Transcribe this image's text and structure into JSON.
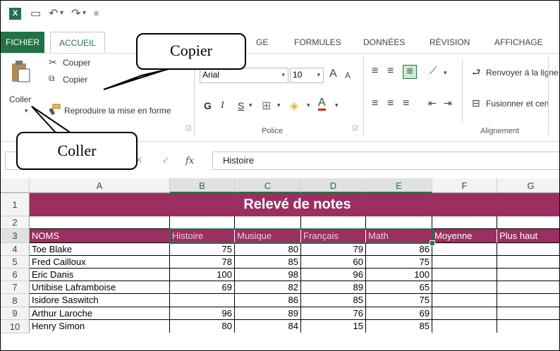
{
  "app": {
    "logo": "X",
    "quick_access": [
      "save-icon",
      "undo-icon",
      "redo-icon",
      "customize-icon"
    ]
  },
  "tabs": {
    "file": "FICHIER",
    "home": "ACCUEIL",
    "insert_tail": "GE",
    "formulas": "FORMULES",
    "data": "DONNÉES",
    "review": "RÉVISION",
    "view": "AFFICHAGE"
  },
  "clipboard": {
    "paste": "Coller",
    "cut": "Couper",
    "copy": "Copier",
    "format_painter": "Reproduire la mise en forme"
  },
  "font": {
    "name": "Arial",
    "size": "10",
    "bold": "G",
    "italic": "I",
    "underline": "S",
    "grow": "A",
    "shrink": "A",
    "group_label": "Police"
  },
  "alignment": {
    "wrap_text": "Renvoyer à la ligne",
    "merge": "Fusionner et cen",
    "group_label": "Alignement"
  },
  "formula_bar": {
    "cancel": "✕",
    "enter": "✓",
    "fx": "fx",
    "content": "Histoire"
  },
  "columns": [
    "A",
    "B",
    "C",
    "D",
    "E",
    "F",
    "G"
  ],
  "rows": [
    "1",
    "2",
    "3",
    "4",
    "5",
    "6",
    "7",
    "8",
    "9",
    "10"
  ],
  "sheet": {
    "title": "Relevé de notes",
    "headers": [
      "NOMS",
      "Histoire",
      "Musique",
      "Français",
      "Math",
      "Moyenne",
      "Plus haut"
    ],
    "data": [
      [
        "Toe Blake",
        "75",
        "80",
        "79",
        "86"
      ],
      [
        "Fred Cailloux",
        "78",
        "85",
        "60",
        "75"
      ],
      [
        "Eric Danis",
        "100",
        "98",
        "96",
        "100"
      ],
      [
        "Urtibise Laframboise",
        "69",
        "82",
        "89",
        "65"
      ],
      [
        "Isidore Saswitch",
        "",
        "86",
        "85",
        "75"
      ],
      [
        "Arthur Laroche",
        "96",
        "89",
        "76",
        "69"
      ]
    ],
    "partial_row": [
      "Henry Simon",
      "80",
      "84",
      "15",
      "85"
    ]
  },
  "callouts": {
    "copy": "Copier",
    "paste": "Coller"
  },
  "colors": {
    "accent": "#217346",
    "title_fill": "#9b2f62"
  }
}
